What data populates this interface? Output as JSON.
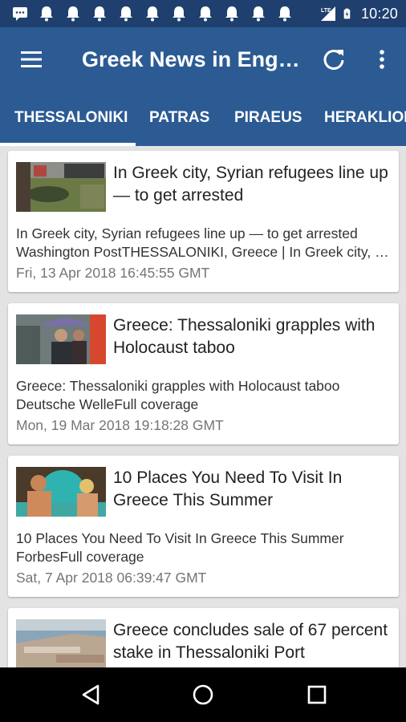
{
  "status_bar": {
    "time": "10:20",
    "left_icons": [
      "messages-icon",
      "notification-bell-icon",
      "notification-bell-icon",
      "notification-bell-icon",
      "notification-bell-icon",
      "notification-bell-icon",
      "notification-bell-icon",
      "notification-bell-icon",
      "notification-bell-icon",
      "notification-bell-icon"
    ],
    "right_icons": [
      "lte-signal-icon",
      "battery-charging-icon"
    ]
  },
  "app_bar": {
    "title": "Greek News in English",
    "menu_icon": "hamburger-menu-icon",
    "refresh_icon": "refresh-icon",
    "more_icon": "more-vert-icon"
  },
  "tabs": [
    {
      "label": "THESSALONIKI",
      "selected": true
    },
    {
      "label": "PATRAS",
      "selected": false
    },
    {
      "label": "PIRAEUS",
      "selected": false
    },
    {
      "label": "HERAKLION",
      "selected": false
    }
  ],
  "articles": [
    {
      "headline": "In Greek city, Syrian refugees line up — to get arrested",
      "summary_line1": "In Greek city, Syrian refugees line up — to get arrested",
      "summary_line2": "Washington PostTHESSALONIKI, Greece | In Greek city, Syrian refugees line up",
      "date": "Fri, 13 Apr 2018 16:45:55 GMT"
    },
    {
      "headline": "Greece: Thessaloniki grapples with Holocaust taboo",
      "summary_line1": "Greece: Thessaloniki grapples with Holocaust taboo",
      "summary_line2": "Deutsche WelleFull coverage",
      "date": "Mon, 19 Mar 2018 19:18:28 GMT"
    },
    {
      "headline": "10 Places You Need To Visit In Greece This Summer",
      "summary_line1": "10 Places You Need To Visit In Greece This Summer",
      "summary_line2": "ForbesFull coverage",
      "date": "Sat, 7 Apr 2018 06:39:47 GMT"
    },
    {
      "headline": "Greece concludes sale of 67 percent stake in Thessaloniki Port",
      "summary_line1": "",
      "summary_line2": "",
      "date": ""
    }
  ],
  "nav_bar": {
    "back_icon": "back-triangle-icon",
    "home_icon": "home-circle-icon",
    "recents_icon": "recents-square-icon"
  },
  "colors": {
    "status_bar": "#1f3f6e",
    "app_bar": "#2c5b93",
    "background": "#e3e3e3"
  }
}
